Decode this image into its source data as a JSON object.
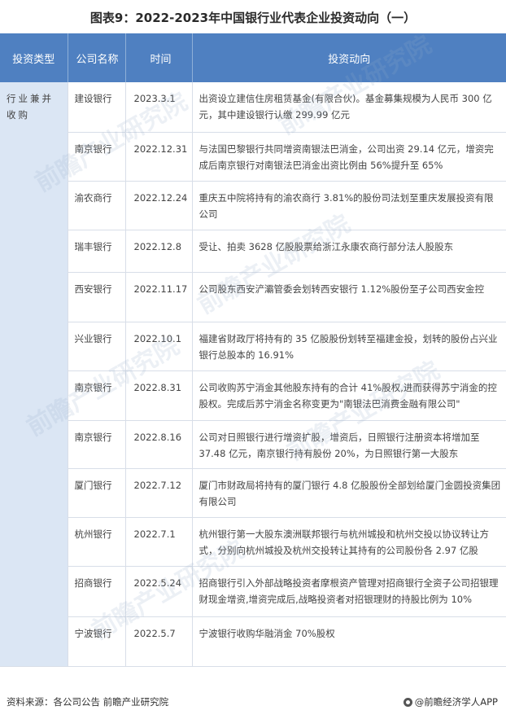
{
  "title": "图表9：2022-2023年中国银行业代表企业投资动向（一）",
  "table": {
    "headers": [
      "投资类型",
      "公司名称",
      "时间",
      "投资动向"
    ],
    "type": "行业兼并收购",
    "rows": [
      {
        "company": "建设银行",
        "time": "2023.3.1",
        "content": "出资设立建信住房租赁基金(有限合伙)。基金募集规模为人民币 300 亿元，其中建设银行认缴 299.99 亿元"
      },
      {
        "company": "南京银行",
        "time": "2022.12.31",
        "content": "与法国巴黎银行共同增资南银法巴消金，公司出资 29.14 亿元，增资完成后南京银行对南银法巴消金出资比例由 56%提升至 65%"
      },
      {
        "company": "渝农商行",
        "time": "2022.12.24",
        "content": "重庆五中院将持有的渝农商行 3.81%的股份司法划至重庆发展投资有限公司"
      },
      {
        "company": "瑞丰银行",
        "time": "2022.12.8",
        "content": "受让、拍卖 3628 亿股股票给浙江永康农商行部分法人股股东"
      },
      {
        "company": "西安银行",
        "time": "2022.11.17",
        "content": "公司股东西安浐灞管委会划转西安银行 1.12%股份至子公司西安金控"
      },
      {
        "company": "兴业银行",
        "time": "2022.10.1",
        "content": "福建省财政厅将持有的 35 亿股股份划转至福建金投，划转的股份占兴业银行总股本的 16.91%"
      },
      {
        "company": "南京银行",
        "time": "2022.8.31",
        "content": "公司收购苏宁消金其他股东持有的合计 41%股权,进而获得苏宁消金的控股权。完成后苏宁消金名称变更为\"南银法巴消费金融有限公司\""
      },
      {
        "company": "南京银行",
        "time": "2022.8.16",
        "content": "公司对日照银行进行增资扩股，增资后，日照银行注册资本将增加至 37.48 亿元，南京银行持有股份 20%，为日照银行第一大股东"
      },
      {
        "company": "厦门银行",
        "time": "2022.7.12",
        "content": "厦门市财政局将持有的厦门银行 4.8 亿股股份全部划给厦门金圆投资集团有限公司"
      },
      {
        "company": "杭州银行",
        "time": "2022.7.1",
        "content": "杭州银行第一大股东澳洲联邦银行与杭州城投和杭州交投以协议转让方式，分别向杭州城投及杭州交投转让其持有的公司股份各 2.97 亿股"
      },
      {
        "company": "招商银行",
        "time": "2022.5.24",
        "content": "招商银行引入外部战略投资者摩根资产管理对招商银行全资子公司招银理财现金增资,增资完成后,战略投资者对招银理财的持股比例为 10%"
      },
      {
        "company": "宁波银行",
        "time": "2022.5.7",
        "content": "宁波银行收购华融消金 70%股权"
      }
    ]
  },
  "footer": {
    "source": "资料来源：各公司公告 前瞻产业研究院",
    "brand": "@前瞻经济学人APP",
    "logo_icon": "qianzhan-logo-icon"
  },
  "watermark": "前瞻产业研究院"
}
